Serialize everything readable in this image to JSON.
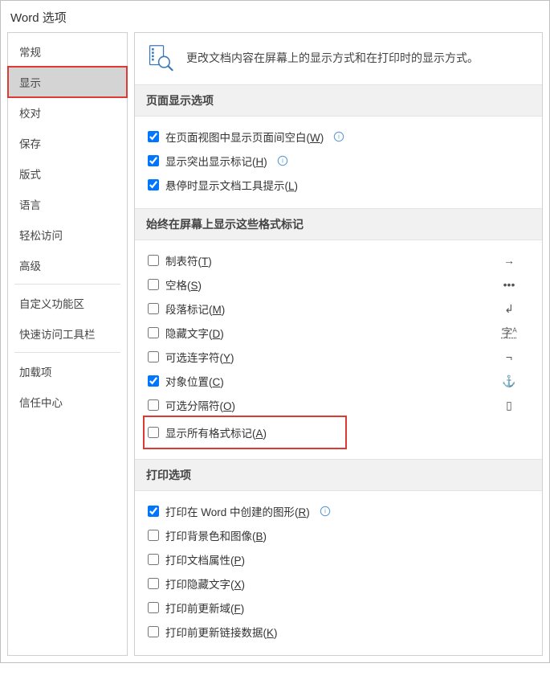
{
  "title": "Word 选项",
  "sidebar": {
    "items": [
      {
        "label": "常规"
      },
      {
        "label": "显示"
      },
      {
        "label": "校对"
      },
      {
        "label": "保存"
      },
      {
        "label": "版式"
      },
      {
        "label": "语言"
      },
      {
        "label": "轻松访问"
      },
      {
        "label": "高级"
      },
      {
        "label": "自定义功能区"
      },
      {
        "label": "快速访问工具栏"
      },
      {
        "label": "加载项"
      },
      {
        "label": "信任中心"
      }
    ]
  },
  "hero": "更改文档内容在屏幕上的显示方式和在打印时的显示方式。",
  "sections": {
    "page_display": {
      "header": "页面显示选项",
      "opt0": "在页面视图中显示页面间空白(W)",
      "opt1": "显示突出显示标记(H)",
      "opt2": "悬停时显示文档工具提示(L)"
    },
    "format_marks": {
      "header": "始终在屏幕上显示这些格式标记",
      "opt0": "制表符(T)",
      "opt1": "空格(S)",
      "opt2": "段落标记(M)",
      "opt3": "隐藏文字(D)",
      "opt4": "可选连字符(Y)",
      "opt5": "对象位置(C)",
      "opt6": "可选分隔符(O)",
      "opt7": "显示所有格式标记(A)"
    },
    "print": {
      "header": "打印选项",
      "opt0": "打印在 Word 中创建的图形(R)",
      "opt1": "打印背景色和图像(B)",
      "opt2": "打印文档属性(P)",
      "opt3": "打印隐藏文字(X)",
      "opt4": "打印前更新域(F)",
      "opt5": "打印前更新链接数据(K)"
    }
  }
}
